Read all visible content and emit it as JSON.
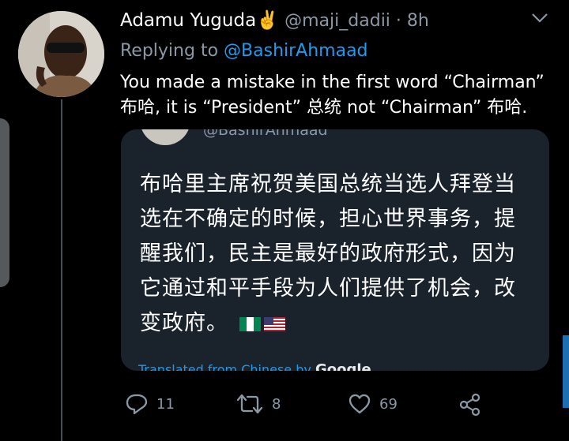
{
  "tweet": {
    "author_name": "Adamu Yuguda",
    "author_emoji": "✌️",
    "handle": "@maji_dadii",
    "separator": " · ",
    "time": "8h",
    "replying_prefix": "Replying to ",
    "replying_handle": "@BashirAhmaad",
    "text_line1": "You made a mistake in the first word “Chairman”",
    "text_line2": "布哈, it is “President” 总统 not “Chairman”  布哈."
  },
  "quote": {
    "handle": "@BashirAhmaad",
    "text": "布哈里主席祝贺美国总统当选人拜登当选在不确定的时候，担心世界事务，提醒我们，民主是最好的政府形式，因为它通过和平手段为人们提供了机会，改变政府。",
    "flags": [
      "nigeria-flag",
      "us-flag"
    ],
    "translated_label": "Translated from Chinese by",
    "translated_brand": "Google"
  },
  "actions": {
    "reply_count": "11",
    "retweet_count": "8",
    "like_count": "69"
  },
  "colors": {
    "background": "#000000",
    "card": "#1a222c",
    "accent": "#1d9bf0",
    "muted": "#8b98a5"
  }
}
